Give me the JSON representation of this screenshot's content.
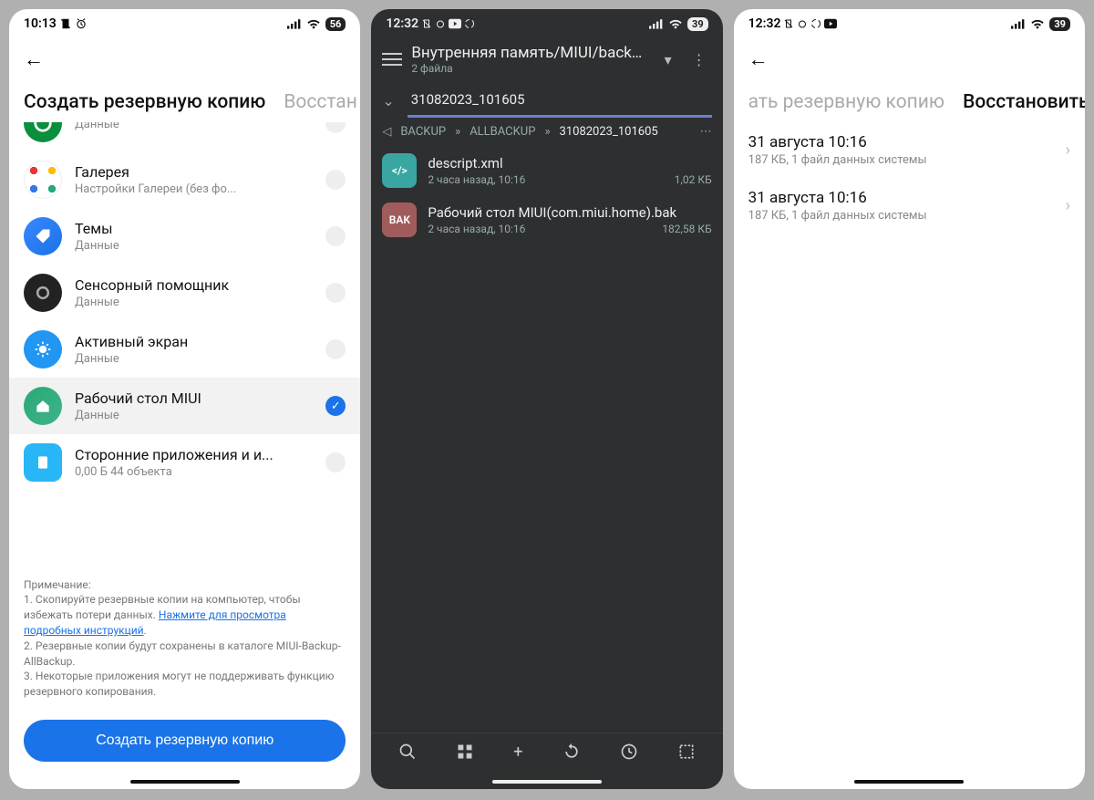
{
  "phone1": {
    "status": {
      "time": "10:13",
      "battery": "56"
    },
    "tabs": {
      "active": "Создать резервную копию",
      "inactive": "Восстан"
    },
    "items": [
      {
        "title": "",
        "sub": "Данные"
      },
      {
        "title": "Галерея",
        "sub": "Настройки Галереи (без фо..."
      },
      {
        "title": "Темы",
        "sub": "Данные"
      },
      {
        "title": "Сенсорный помощник",
        "sub": "Данные"
      },
      {
        "title": "Активный экран",
        "sub": "Данные"
      },
      {
        "title": "Рабочий стол MIUI",
        "sub": "Данные"
      },
      {
        "title": "Сторонние приложения и и...",
        "sub": "0,00 Б  44 объекта"
      }
    ],
    "notes": {
      "header": "Примечание:",
      "n1": "1. Скопируйте резервные копии на компьютер, чтобы избежать потери данных. ",
      "link": "Нажмите для просмотра подробных инструкций",
      "n2": "2. Резервные копии будут сохранены в каталоге MIUI-Backup-AllBackup.",
      "n3": "3. Некоторые приложения могут не поддерживать функцию резервного копирования."
    },
    "button": "Создать резервную копию"
  },
  "phone2": {
    "status": {
      "time": "12:32",
      "battery": "39"
    },
    "header": {
      "path": "Внутренняя память/MIUI/backup/...",
      "count": "2 файла"
    },
    "tab": "31082023_101605",
    "breadcrumbs": {
      "b1": "BACKUP",
      "b2": "ALLBACKUP",
      "b3": "31082023_101605",
      "sep": "»"
    },
    "files": [
      {
        "icon": "</>",
        "name": "descript.xml",
        "meta_time": "2 часа назад, 10:16",
        "meta_size": "1,02  КБ"
      },
      {
        "icon": "BAK",
        "name": "Рабочий стол MIUI(com.miui.home).bak",
        "meta_time": "2 часа назад, 10:16",
        "meta_size": "182,58  КБ"
      }
    ]
  },
  "phone3": {
    "status": {
      "time": "12:32",
      "battery": "39"
    },
    "tabs": {
      "inactive": "ать резервную копию",
      "active": "Восстановить"
    },
    "items": [
      {
        "title": "31 августа 10:16",
        "sub": "187 КБ, 1 файл данных системы"
      },
      {
        "title": "31 августа 10:16",
        "sub": "187 КБ, 1 файл данных системы"
      }
    ]
  }
}
